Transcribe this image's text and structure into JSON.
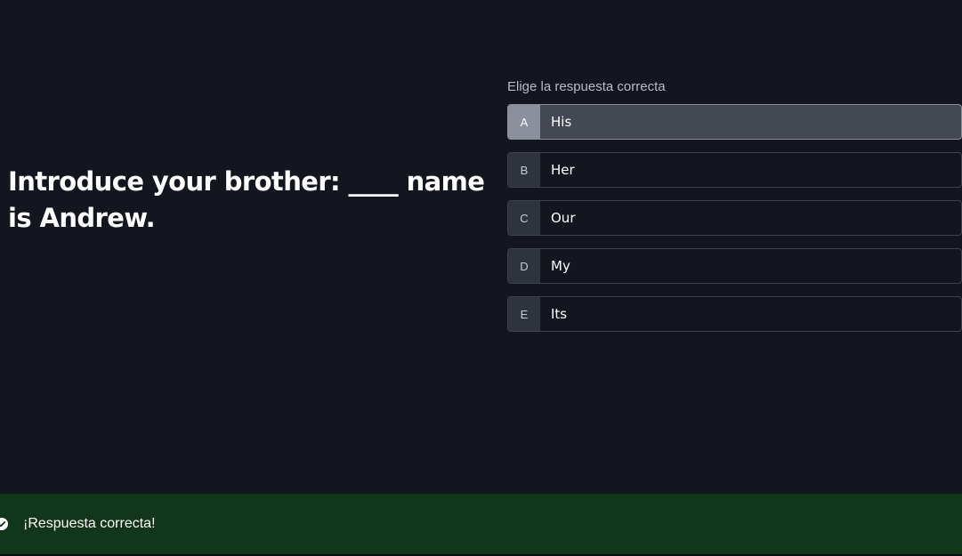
{
  "question": {
    "text": "Introduce your brother: ____ name is Andrew."
  },
  "instruction": "Elige la respuesta correcta",
  "options": [
    {
      "key": "A",
      "text": "His",
      "selected": true
    },
    {
      "key": "B",
      "text": "Her",
      "selected": false
    },
    {
      "key": "C",
      "text": "Our",
      "selected": false
    },
    {
      "key": "D",
      "text": "My",
      "selected": false
    },
    {
      "key": "E",
      "text": "Its",
      "selected": false
    }
  ],
  "feedback": {
    "icon": "check-circle-icon",
    "text": "¡Respuesta correcta!",
    "color": "#123619"
  },
  "colors": {
    "background": "#13161f",
    "selected_option": "#434852"
  }
}
